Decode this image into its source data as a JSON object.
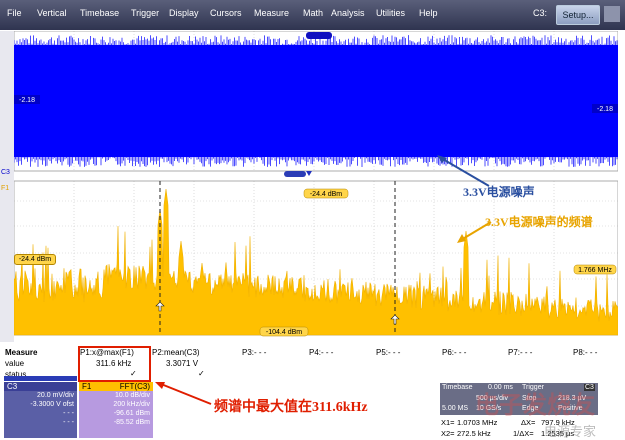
{
  "menu": [
    "File",
    "Vertical",
    "Timebase",
    "Trigger",
    "Display",
    "Cursors",
    "Measure",
    "Math",
    "Analysis",
    "Utilities",
    "Help"
  ],
  "channel_indicator": "C3:",
  "setup_label": "Setup...",
  "trace_labels": {
    "c3_left": "C3",
    "f1_left": "F1",
    "top_offset_left": "-2.18",
    "top_offset_right": "-2.18",
    "f1_level_left": "-24.4 dBm",
    "f1_top_marker": "-24.4 dBm",
    "f1_bottom_marker": "-104.4 dBm",
    "f1_right": "1.766 MHz"
  },
  "annotations": {
    "noise": "3.3V电源噪声",
    "spectrum": "3.3V电源噪声的频谱",
    "max": "频谱中最大值在311.6kHz"
  },
  "measure": {
    "title": "Measure",
    "row_labels": [
      "value",
      "status"
    ],
    "params": [
      {
        "name": "P1:x@max(F1)",
        "value": "311.6 kHz",
        "status": "✓"
      },
      {
        "name": "P2:mean(C3)",
        "value": "3.3071 V",
        "status": "✓"
      },
      {
        "name": "P3:- - -",
        "value": "",
        "status": ""
      },
      {
        "name": "P4:- - -",
        "value": "",
        "status": ""
      },
      {
        "name": "P5:- - -",
        "value": "",
        "status": ""
      },
      {
        "name": "P6:- - -",
        "value": "",
        "status": ""
      },
      {
        "name": "P7:- - -",
        "value": "",
        "status": ""
      },
      {
        "name": "P8:- - -",
        "value": "",
        "status": ""
      }
    ]
  },
  "c3_panel": {
    "name": "C3",
    "line1": "20.0 mV/div",
    "line2": "-3.3000 V ofst",
    "line3": "- - -",
    "line4": "- - -"
  },
  "f1_panel": {
    "name": "F1",
    "func": "FFT(C3)",
    "line1": "10.0 dB/div",
    "line2": "200 kHz/div",
    "line3": "-96.61 dBm",
    "line4": "-85.52 dBm"
  },
  "timebase": {
    "label": "Timebase",
    "value": "0.00 ms",
    "r1": "500 µs/div",
    "r2": "5.00 MS",
    "r3": "10 GS/s",
    "trigger_label": "Trigger",
    "trigger_ch": "C3",
    "trig1": "Stop",
    "trig2": "218.3 µV",
    "trig3": "Edge",
    "trig4": "Positive"
  },
  "cursors": {
    "x1": "X1=",
    "x1v": "1.0703 MHz",
    "dx1": "ΔX=",
    "dx1v": "797.9 kHz",
    "x2": "X2=",
    "x2v": "272.5 kHz",
    "dx2": "1/ΔX=",
    "dx2v": "1.2535 µs"
  },
  "watermark": "电子发烧友",
  "watermark2": "电源专家",
  "colors": {
    "c3_trace": "#0000ff",
    "f1_trace": "#ffc000",
    "annot_blue": "#2a4fa0",
    "annot_red": "#e01e00"
  }
}
